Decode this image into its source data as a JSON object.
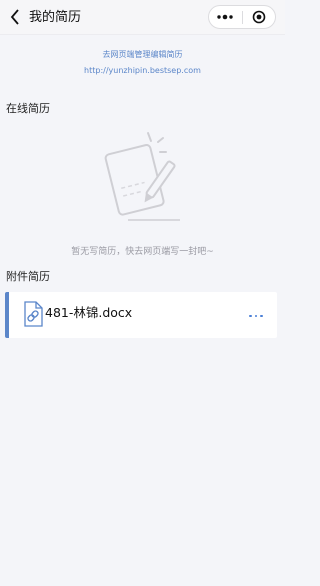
{
  "navbar": {
    "title": "我的简历"
  },
  "hint": {
    "line1": "去网页端管理编辑简历",
    "line2": "http://yunzhipin.bestsep.com"
  },
  "online_resume": {
    "section_title": "在线简历",
    "empty_text": "暂无写简历，快去网页端写一封吧~"
  },
  "attachment_resume": {
    "section_title": "附件简历",
    "files": [
      {
        "name": "481-林锦.docx"
      }
    ]
  },
  "colors": {
    "accent": "#5b86c9",
    "page_bg": "#f4f5f9",
    "more_dots": "#4a7fd6"
  }
}
